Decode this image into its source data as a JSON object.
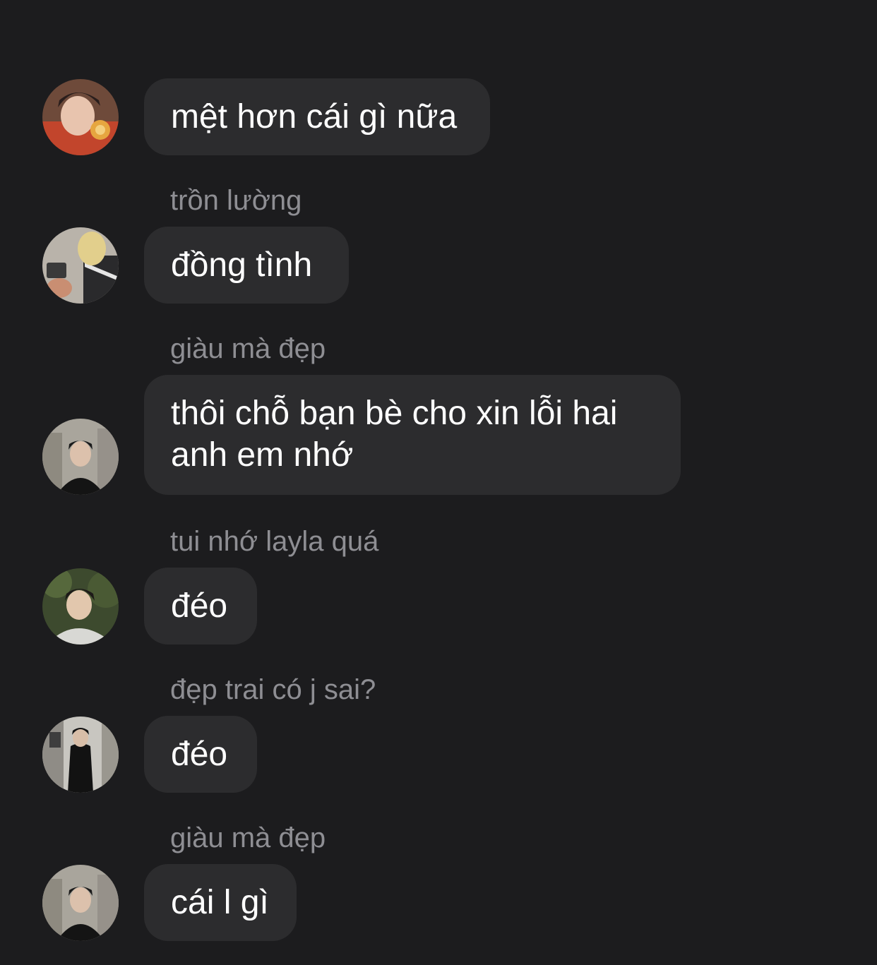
{
  "messages": [
    {
      "sender": "",
      "text": "mệt hơn cái gì nữa",
      "avatar": "profile-photo-red-sweater-lollipop"
    },
    {
      "sender": "trồn lường",
      "text": "đồng tình",
      "avatar": "profile-photo-blond-hair-camera"
    },
    {
      "sender": "giàu mà đẹp",
      "text": "thôi chỗ bạn bè cho xin lỗi hai\nanh em nhớ",
      "avatar": "profile-photo-dark-hair-black-shirt-street"
    },
    {
      "sender": "tui nhớ layla quá",
      "text": "đéo",
      "avatar": "profile-photo-dark-hair-white-shirt-trees"
    },
    {
      "sender": "đẹp trai có j sai?",
      "text": "đéo",
      "avatar": "profile-photo-black-outfit-full-body"
    },
    {
      "sender": "giàu mà đẹp",
      "text": "cái l gì",
      "avatar": "profile-photo-dark-hair-black-shirt-street"
    }
  ],
  "colors": {
    "background": "#1c1c1e",
    "bubble": "#2c2c2e",
    "bubble_text": "#ffffff",
    "sender_text": "#8e8e93"
  }
}
